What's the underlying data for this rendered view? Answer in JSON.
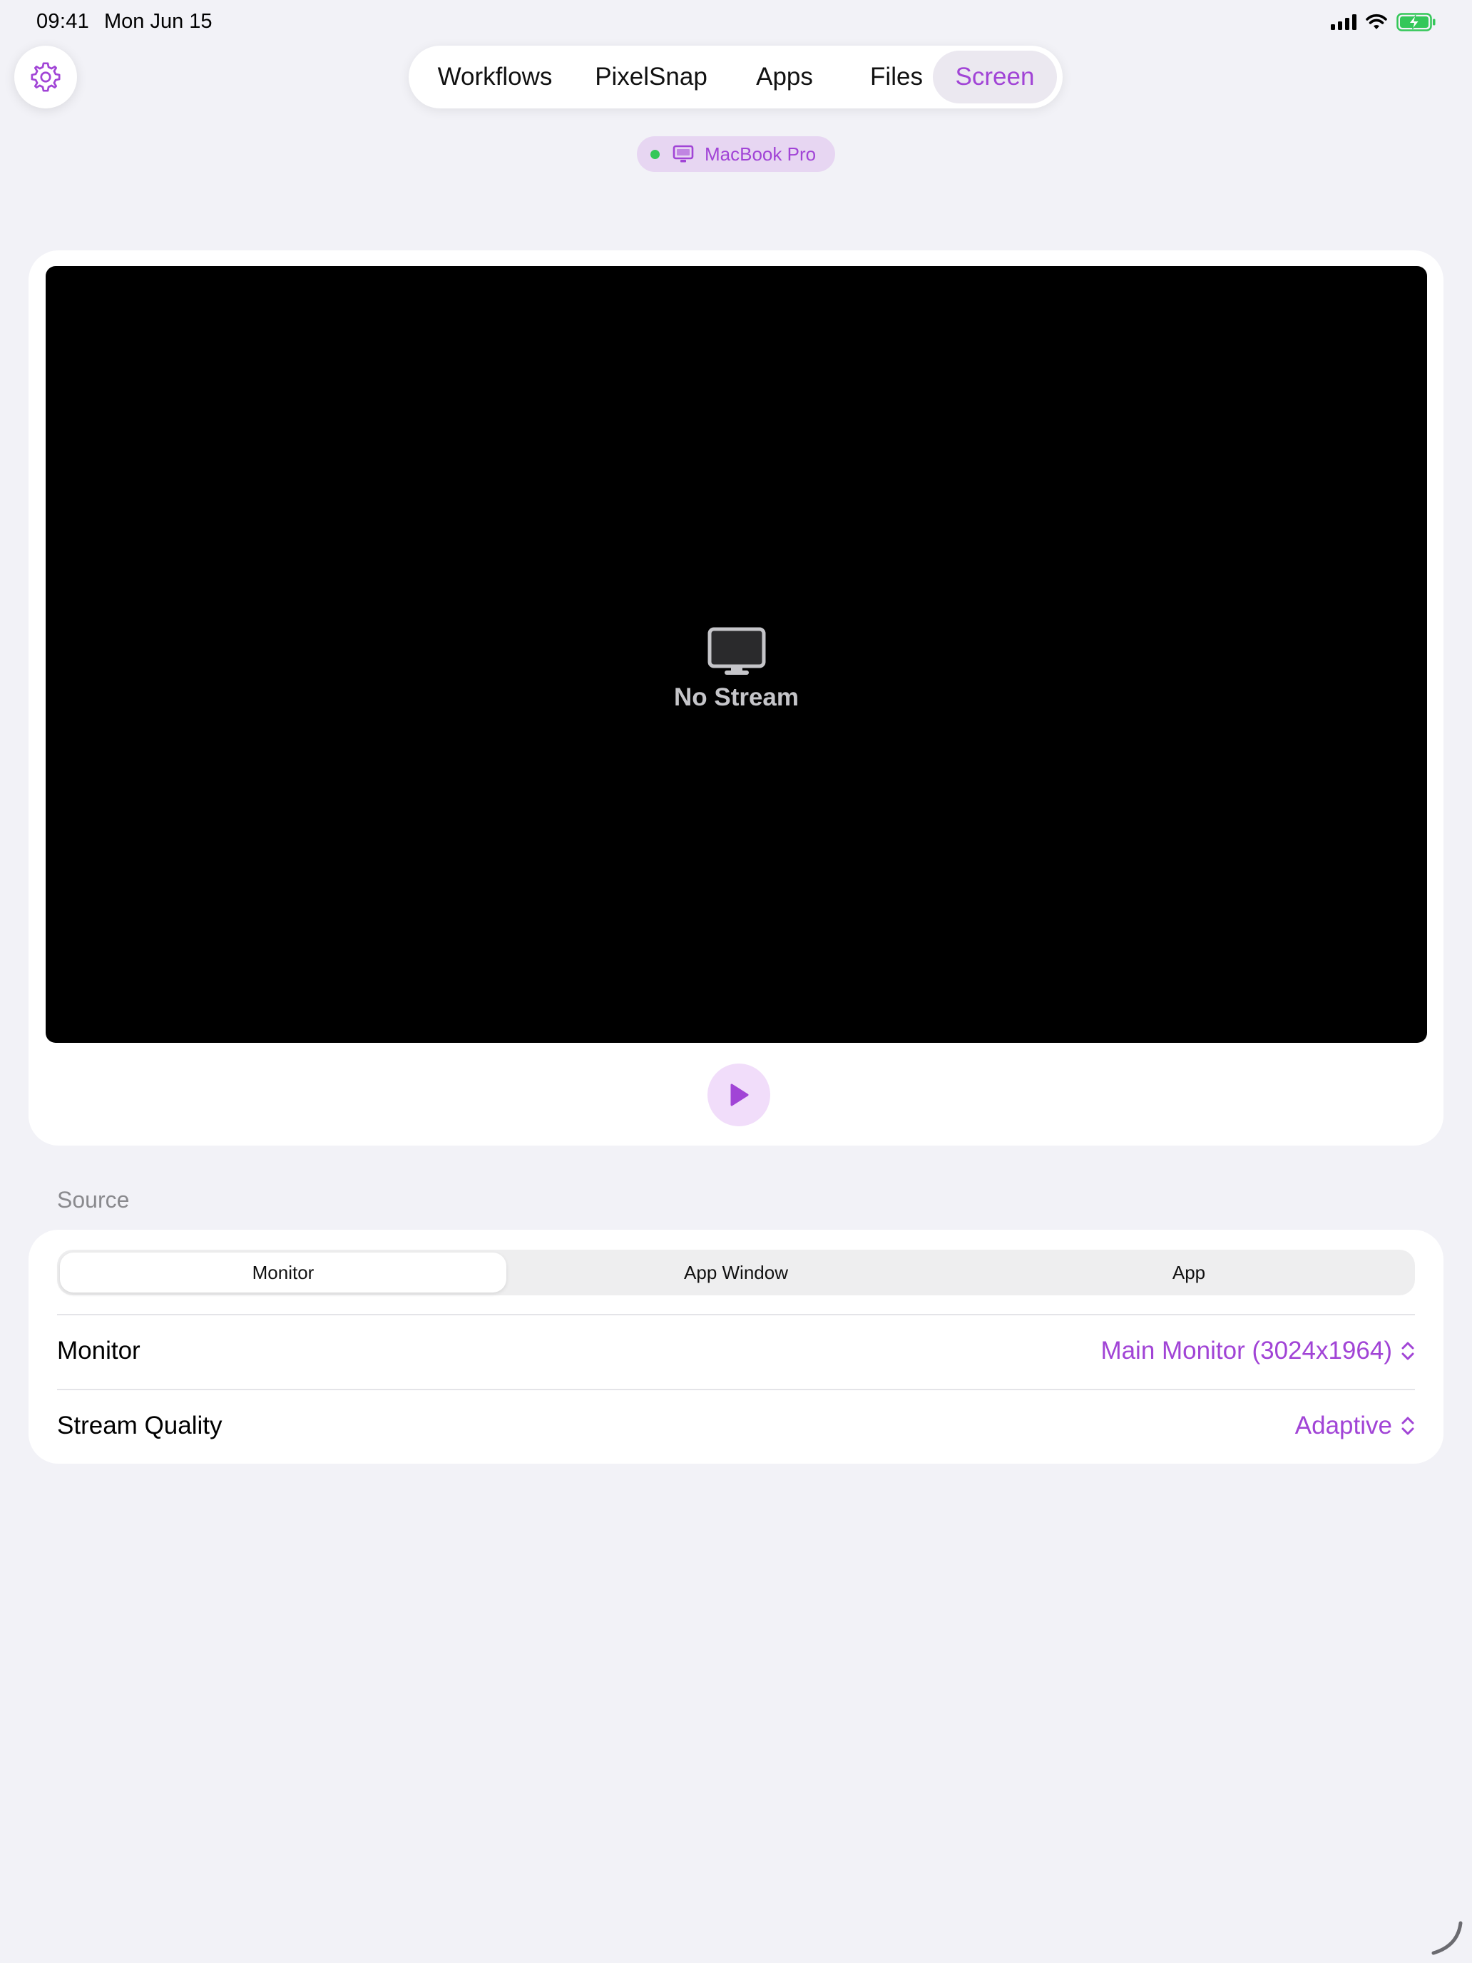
{
  "status_bar": {
    "time": "09:41",
    "date": "Mon Jun 15",
    "icons": [
      "cellular-signal-icon",
      "wifi-icon",
      "battery-charging-icon"
    ]
  },
  "settings": {
    "icon": "gear-icon"
  },
  "tabs": [
    {
      "label": "Workflows",
      "active": false
    },
    {
      "label": "PixelSnap",
      "active": false
    },
    {
      "label": "Apps",
      "active": false
    },
    {
      "label": "Files",
      "active": false
    },
    {
      "label": "Screen",
      "active": true
    }
  ],
  "device": {
    "name": "MacBook Pro",
    "status": "connected",
    "icon": "laptop-icon"
  },
  "stream": {
    "placeholder": "No Stream",
    "placeholder_icon": "display-icon",
    "play_icon": "play-icon"
  },
  "source": {
    "header": "Source",
    "segments": [
      {
        "label": "Monitor",
        "selected": true
      },
      {
        "label": "App Window",
        "selected": false
      },
      {
        "label": "App",
        "selected": false
      }
    ],
    "rows": [
      {
        "label": "Monitor",
        "value": "Main Monitor (3024x1964)"
      },
      {
        "label": "Stream Quality",
        "value": "Adaptive"
      }
    ]
  },
  "colors": {
    "accent": "#a144d6",
    "background": "#f2f2f7",
    "chip_background": "#e7d6f2",
    "online": "#34c759",
    "battery": "#34c759"
  }
}
